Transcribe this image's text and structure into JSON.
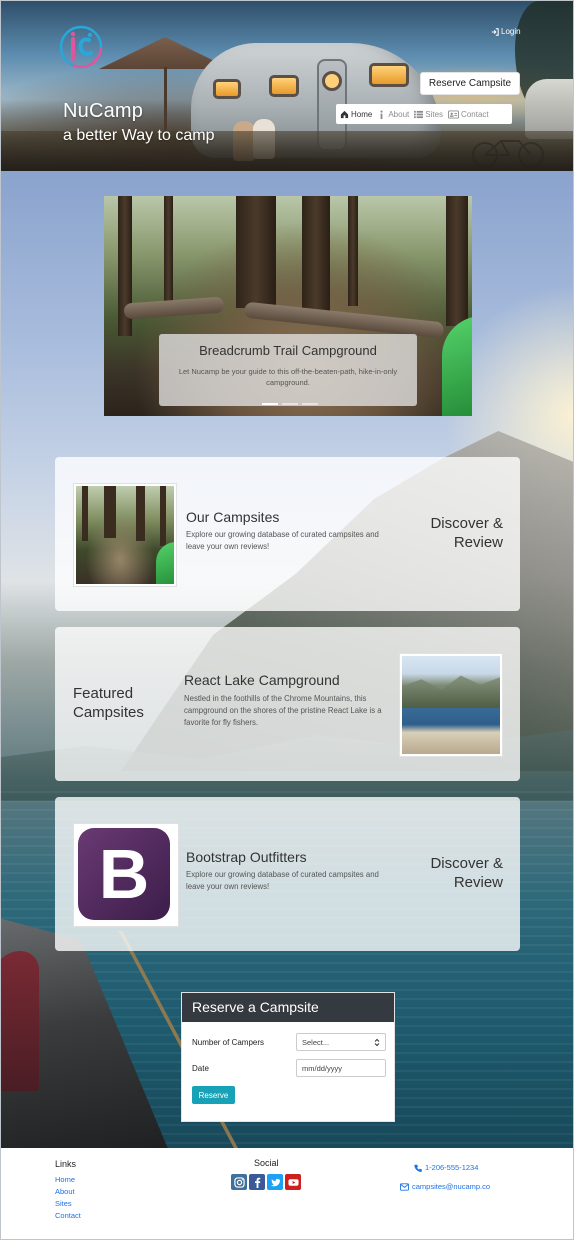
{
  "header": {
    "brand_title": "NuCamp",
    "tagline": "a better Way to camp",
    "login_label": "Login",
    "reserve_button": "Reserve Campsite",
    "nav": [
      {
        "label": "Home",
        "icon": "home-icon",
        "active": true
      },
      {
        "label": "About",
        "icon": "info-icon",
        "active": false
      },
      {
        "label": "Sites",
        "icon": "list-icon",
        "active": false
      },
      {
        "label": "Contact",
        "icon": "address-card-icon",
        "active": false
      }
    ]
  },
  "carousel": {
    "title": "Breadcrumb Trail Campground",
    "text": "Let Nucamp be your guide to this off-the-beaten-path, hike-in-only campground."
  },
  "cards": [
    {
      "title": "Our Campsites",
      "text": "Explore our growing database of curated campsites and leave your own reviews!",
      "side_line1": "Discover &",
      "side_line2": "Review"
    },
    {
      "title": "React Lake Campground",
      "text": "Nestled in the foothills of the Chrome Mountains, this campground on the shores of the pristine React Lake is a favorite for fly fishers.",
      "side_line1": "Featured",
      "side_line2": "Campsites"
    },
    {
      "title": "Bootstrap Outfitters",
      "text": "Explore our growing database of curated campsites and leave your own reviews!",
      "side_line1": "Discover &",
      "side_line2": "Review",
      "logo_letter": "B"
    }
  ],
  "reserve_form": {
    "title": "Reserve a Campsite",
    "campers_label": "Number of Campers",
    "campers_value": "Select...",
    "date_label": "Date",
    "date_placeholder": "mm/dd/yyyy",
    "submit_label": "Reserve"
  },
  "footer": {
    "links_title": "Links",
    "links": [
      "Home",
      "About",
      "Sites",
      "Contact"
    ],
    "social_title": "Social",
    "social": [
      {
        "icon": "instagram-icon",
        "color": "#3f729b"
      },
      {
        "icon": "facebook-icon",
        "color": "#3b5998"
      },
      {
        "icon": "twitter-icon",
        "color": "#1da1f2"
      },
      {
        "icon": "youtube-icon",
        "color": "#cd201f"
      }
    ],
    "phone": "1-206-555-1234",
    "email": "campsites@nucamp.co"
  },
  "colors": {
    "accent_teal": "#17a2b8",
    "form_header": "#343a40",
    "link_blue": "#1a73e8"
  }
}
